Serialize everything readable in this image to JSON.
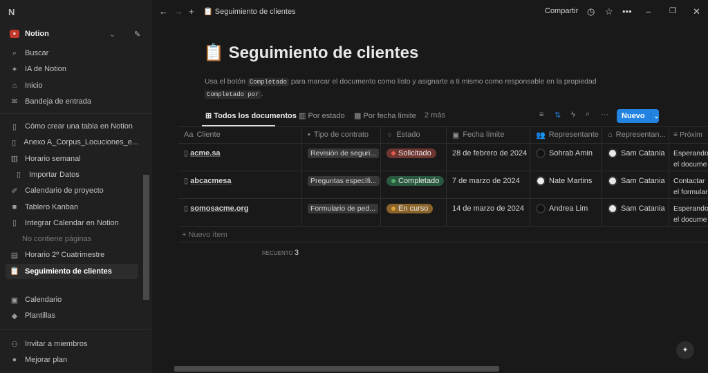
{
  "sidebar": {
    "workspace": "Notion",
    "top": [
      {
        "label": "Buscar",
        "icon": "search-icon"
      },
      {
        "label": "IA de Notion",
        "icon": "sparkle-icon"
      },
      {
        "label": "Inicio",
        "icon": "home-icon"
      },
      {
        "label": "Bandeja de entrada",
        "icon": "inbox-icon"
      }
    ],
    "pages": [
      {
        "label": "Cómo crear una tabla en Notion",
        "icon": "page-icon"
      },
      {
        "label": "Anexo A_Corpus_Locuciones_e...",
        "icon": "page-icon"
      },
      {
        "label": "Horario semanal",
        "icon": "building-icon"
      },
      {
        "label": "Importar Datos",
        "icon": "page-icon"
      },
      {
        "label": "Calendario de proyecto",
        "icon": "pen-icon"
      },
      {
        "label": "Tablero Kanban",
        "icon": "sticky-note-icon"
      },
      {
        "label": "Integrar Calendar en Notion",
        "icon": "page-icon"
      },
      {
        "label": "No contiene páginas",
        "icon": ""
      },
      {
        "label": "Horario 2º Cuatrimestre",
        "icon": "scroll-icon"
      },
      {
        "label": "Seguimiento de clientes",
        "icon": "clipboard-icon"
      }
    ],
    "bottom": [
      {
        "label": "Calendario",
        "icon": "calendar-icon"
      },
      {
        "label": "Plantillas",
        "icon": "shapes-icon"
      }
    ],
    "footer": [
      {
        "label": "Invitar a miembros",
        "icon": "add-member-icon"
      },
      {
        "label": "Mejorar plan",
        "icon": "upgrade-icon"
      }
    ]
  },
  "topbar": {
    "breadcrumb": "Seguimiento de clientes",
    "share": "Compartir"
  },
  "page": {
    "title": "Seguimiento de clientes",
    "desc_1": "Usa el botón",
    "code_1": "Completado",
    "desc_2": "para marcar el documento como listo y asignarte a ti mismo como responsable en la propiedad",
    "code_2": "Completado por",
    "desc_3": "."
  },
  "views": {
    "tabs": [
      "Todos los documentos",
      "Por estado",
      "Por fecha límite"
    ],
    "more": "2 más",
    "new_button": "Nuevo"
  },
  "table": {
    "columns": [
      "Cliente",
      "Tipo de contrato",
      "Estado",
      "Fecha límite",
      "Representante",
      "Representan...",
      "Próxim"
    ],
    "rows": [
      {
        "cliente": "acme.sa",
        "tipo": "Revisión de seguri...",
        "estado": "Solicitado",
        "fecha": "28 de febrero de 2024",
        "rep": "Sohrab Amin",
        "rep2": "Sam Catania",
        "prox1": "Esperando",
        "prox2": "el docume"
      },
      {
        "cliente": "abcacmesa",
        "tipo": "Preguntas específi...",
        "estado": "Completado",
        "fecha": "7 de marzo de 2024",
        "rep": "Nate Martins",
        "rep2": "Sam Catania",
        "prox1": "Contactar",
        "prox2": "el formular"
      },
      {
        "cliente": "somosacme.org",
        "tipo": "Formulario de ped...",
        "estado": "En curso",
        "fecha": "14 de marzo de 2024",
        "rep": "Andrea Lim",
        "rep2": "Sam Catania",
        "prox1": "Esperando",
        "prox2": "el docume"
      }
    ],
    "new_item": "Nuevo ítem",
    "count_label": "RECUENTO",
    "count": "3"
  },
  "colors": {
    "accent": "#2383e2",
    "solicitado": "#6e3630",
    "completado": "#2b593f",
    "en_curso": "#89632a"
  }
}
